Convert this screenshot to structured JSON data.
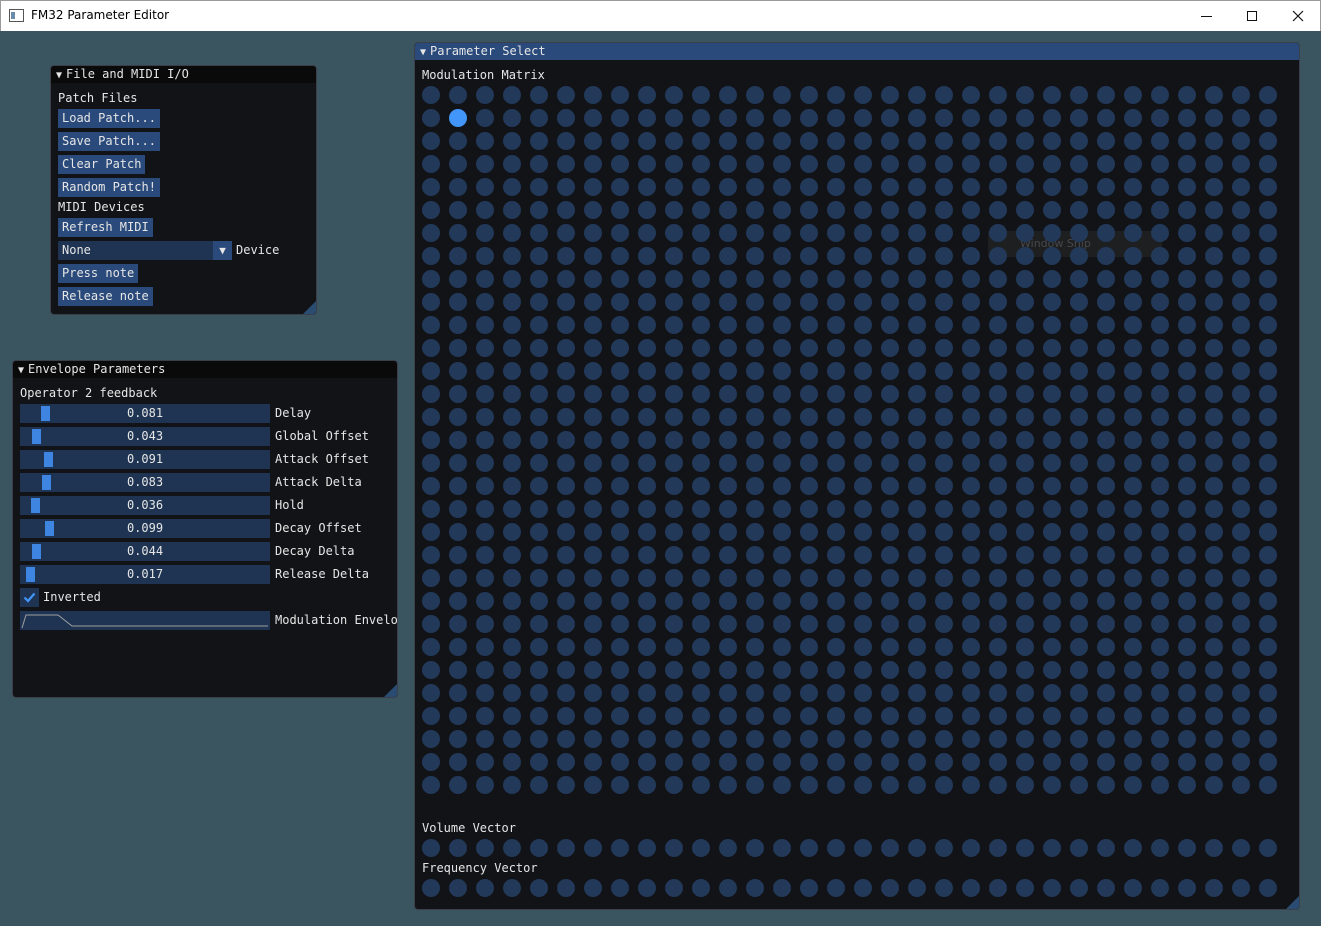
{
  "window": {
    "title": "FM32 Parameter Editor"
  },
  "file_midi": {
    "title": "File and MIDI I/O",
    "patch_files_label": "Patch Files",
    "load_patch": "Load Patch...",
    "save_patch": "Save Patch...",
    "clear_patch": "Clear Patch",
    "random_patch": "Random Patch!",
    "midi_devices_label": "MIDI Devices",
    "refresh_midi": "Refresh MIDI",
    "device_value": "None",
    "device_label": "Device",
    "press_note": "Press note",
    "release_note": "Release note"
  },
  "envelope": {
    "title": "Envelope Parameters",
    "subtitle": "Operator 2 feedback",
    "sliders": [
      {
        "value": "0.081",
        "fraction": 0.081,
        "label": "Delay"
      },
      {
        "value": "0.043",
        "fraction": 0.043,
        "label": "Global Offset"
      },
      {
        "value": "0.091",
        "fraction": 0.091,
        "label": "Attack Offset"
      },
      {
        "value": "0.083",
        "fraction": 0.083,
        "label": "Attack Delta"
      },
      {
        "value": "0.036",
        "fraction": 0.036,
        "label": "Hold"
      },
      {
        "value": "0.099",
        "fraction": 0.099,
        "label": "Decay Offset"
      },
      {
        "value": "0.044",
        "fraction": 0.044,
        "label": "Decay Delta"
      },
      {
        "value": "0.017",
        "fraction": 0.017,
        "label": "Release Delta"
      }
    ],
    "inverted_label": "Inverted",
    "inverted_checked": true,
    "plot_label": "Modulation Envelo"
  },
  "param_select": {
    "title": "Parameter Select",
    "mod_matrix_label": "Modulation Matrix",
    "mod_matrix_rows": 31,
    "mod_matrix_cols": 32,
    "selected_row": 2,
    "selected_col": 2,
    "volume_label": "Volume Vector",
    "frequency_label": "Frequency Vector",
    "vector_cols": 32,
    "window_snip_text": "Window Snip"
  },
  "colors": {
    "dot": "#22395a",
    "dot_selected": "#4296fa",
    "button": "#294a7a",
    "frame": "#1e3452",
    "grab": "#3d85e0"
  }
}
